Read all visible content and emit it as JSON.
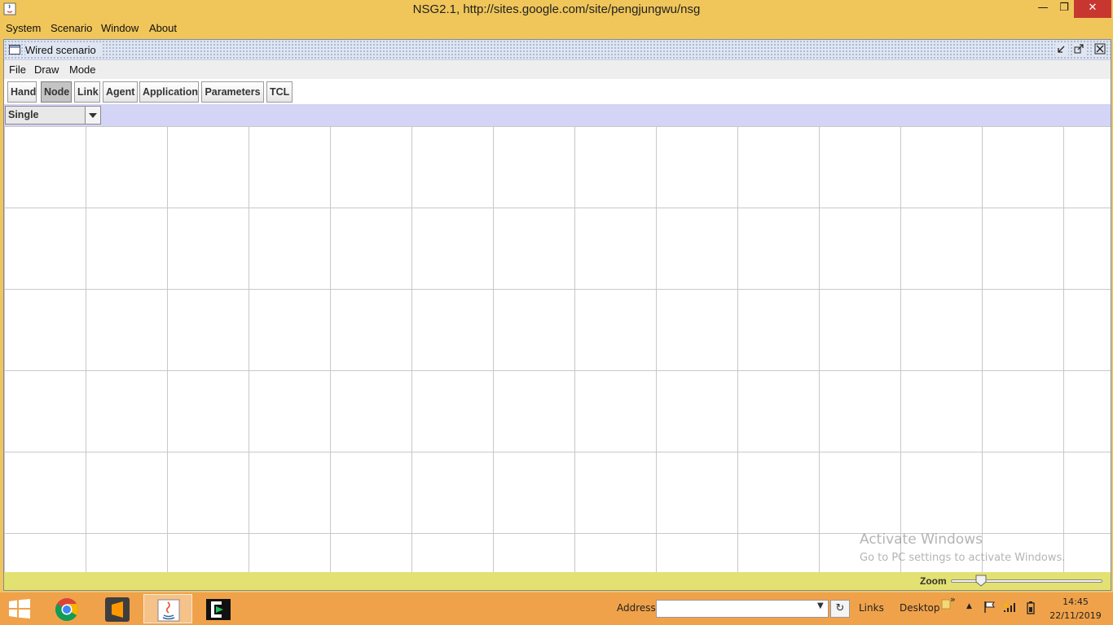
{
  "window": {
    "title": "NSG2.1, http://sites.google.com/site/pengjungwu/nsg",
    "minimize_glyph": "🗕",
    "maximize_glyph": "🗗",
    "close_glyph": "✕"
  },
  "main_menu": [
    "System",
    "Scenario",
    "Window",
    "About"
  ],
  "internal_frame": {
    "title": "Wired scenario",
    "menu": [
      "File",
      "Draw",
      "Mode"
    ],
    "controls": [
      "iconify-icon",
      "maximize-icon",
      "close-icon"
    ]
  },
  "toolbar": {
    "buttons": [
      "Hand",
      "Node",
      "Link",
      "Agent",
      "Application",
      "Parameters",
      "TCL"
    ],
    "active": "Node"
  },
  "options": {
    "mode_select": "Single"
  },
  "canvas": {
    "grid": true
  },
  "watermark": {
    "line1": "Activate Windows",
    "line2": "Go to PC settings to activate Windows."
  },
  "status": {
    "zoom_label": "Zoom",
    "zoom_level": 0.2
  },
  "taskbar": {
    "apps": [
      "chrome-icon",
      "sublime-text-icon",
      "java-icon",
      "terminal-icon"
    ],
    "selected_app": "java-icon",
    "address_label": "Address",
    "address_value": "",
    "links_label": "Links",
    "desktop_label": "Desktop",
    "chevron": "»",
    "time": "14:45",
    "date": "22/11/2019"
  },
  "colors": {
    "title_bar": "#f0c65a",
    "close_button": "#c7372f",
    "options_bar": "#d4d4f6",
    "status_bar": "#e3e172",
    "taskbar": "#f0a24a"
  }
}
